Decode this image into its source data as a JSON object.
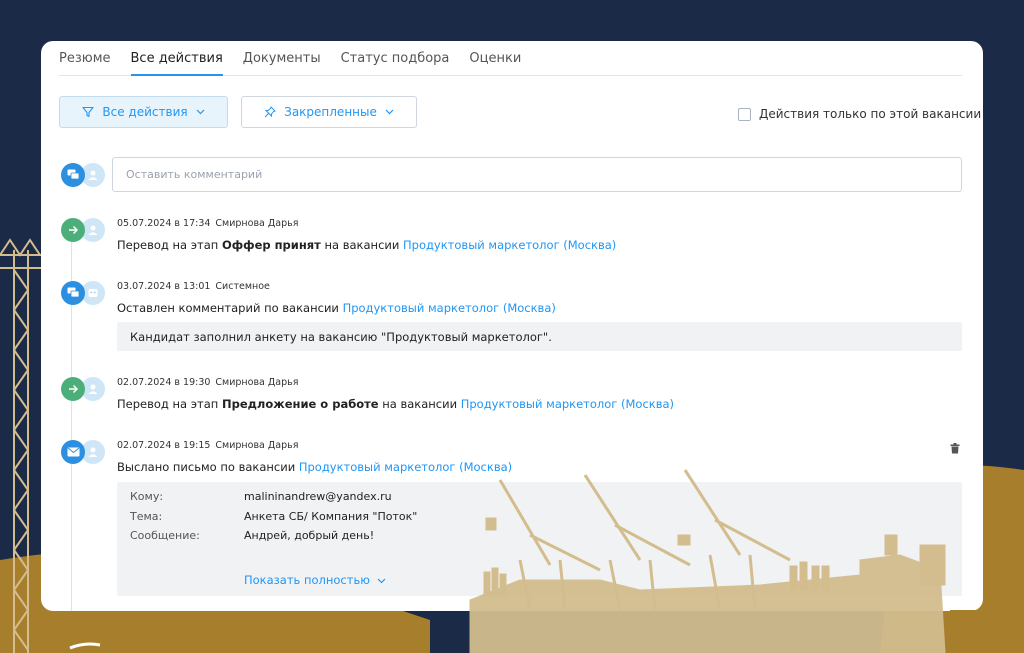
{
  "tabs": [
    "Резюме",
    "Все действия",
    "Документы",
    "Статус подбора",
    "Оценки"
  ],
  "toolbar": {
    "filter_label": "Все действия",
    "pinned_label": "Закрепленные",
    "only_vacancy_label": "Действия только по этой вакансии"
  },
  "comment": {
    "placeholder": "Оставить комментарий"
  },
  "entries": [
    {
      "date": "05.07.2024 в 17:34",
      "author": "Смирнова Дарья",
      "prefix": "Перевод на этап ",
      "stage": "Оффер принят",
      "middle": " на вакансии ",
      "vacancy": "Продуктовый маркетолог (Москва)"
    },
    {
      "date": "03.07.2024 в 13:01",
      "author": "Системное",
      "prefix": "Оставлен комментарий по вакансии ",
      "vacancy": "Продуктовый маркетолог (Москва)",
      "note": "Кандидат заполнил анкету на вакансию \"Продуктовый маркетолог\"."
    },
    {
      "date": "02.07.2024 в 19:30",
      "author": "Смирнова Дарья",
      "prefix": "Перевод на этап ",
      "stage": "Предложение о работе",
      "middle": " на вакансии ",
      "vacancy": "Продуктовый маркетолог (Москва)"
    },
    {
      "date": "02.07.2024 в 19:15",
      "author": "Смирнова Дарья",
      "prefix": "Выслано письмо по вакансии ",
      "vacancy": "Продуктовый маркетолог (Москва)",
      "mail": {
        "to_label": "Кому:",
        "to": "malininandrew@yandex.ru",
        "subject_label": "Тема:",
        "subject": "Анкета СБ/ Компания \"Поток\"",
        "message_label": "Сообщение:",
        "message": "Андрей, добрый день!",
        "show_more": "Показать полностью"
      }
    }
  ],
  "colors": {
    "accent": "#2196f3",
    "stage_icon": "#4caf7a",
    "comment_icon": "#2d8fe0",
    "background": "#1a2a47",
    "hills": "#a77f2c",
    "silhouette": "#d3bd8e"
  },
  "icons": [
    "filter-icon",
    "pin-icon",
    "chevron-down-icon",
    "comment-icon",
    "user-icon",
    "arrow-right-icon",
    "bot-icon",
    "mail-icon",
    "trash-icon"
  ]
}
